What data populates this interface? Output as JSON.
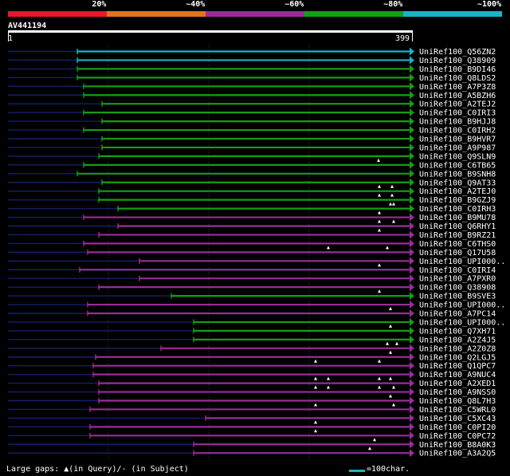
{
  "legend": {
    "segments": [
      {
        "color": "#e8172b"
      },
      {
        "color": "#e27419"
      },
      {
        "color": "#9a2c99"
      },
      {
        "color": "#12a012"
      },
      {
        "color": "#17b5c6"
      }
    ],
    "labels": [
      "20%",
      "~40%",
      "~60%",
      "~80%",
      "~100%"
    ]
  },
  "query": {
    "name": "AV441194",
    "start": "1",
    "end": "399"
  },
  "hits": [
    {
      "name": "UniRef100_Q56ZN2",
      "start": 97,
      "color": "#17b5c6",
      "marks": []
    },
    {
      "name": "UniRef100_Q38909",
      "start": 97,
      "color": "#17b5c6",
      "marks": []
    },
    {
      "name": "UniRef100_B9DI46",
      "start": 97,
      "color": "#12a012",
      "marks": []
    },
    {
      "name": "UniRef100_Q8LDS2",
      "start": 97,
      "color": "#12a012",
      "marks": []
    },
    {
      "name": "UniRef100_A7P3Z8",
      "start": 105,
      "color": "#12a012",
      "marks": []
    },
    {
      "name": "UniRef100_A5BZH6",
      "start": 105,
      "color": "#12a012",
      "marks": []
    },
    {
      "name": "UniRef100_A2TEJ2",
      "start": 128,
      "color": "#12a012",
      "marks": []
    },
    {
      "name": "UniRef100_C0IRI3",
      "start": 105,
      "color": "#12a012",
      "marks": []
    },
    {
      "name": "UniRef100_B9HJJ8",
      "start": 128,
      "color": "#12a012",
      "marks": []
    },
    {
      "name": "UniRef100_C0IRH2",
      "start": 105,
      "color": "#12a012",
      "marks": []
    },
    {
      "name": "UniRef100_B9HVR7",
      "start": 128,
      "color": "#12a012",
      "marks": []
    },
    {
      "name": "UniRef100_A9P987",
      "start": 128,
      "color": "#12a012",
      "marks": []
    },
    {
      "name": "UniRef100_Q9SLN9",
      "start": 124,
      "color": "#12a012",
      "marks": []
    },
    {
      "name": "UniRef100_C6TB65",
      "start": 105,
      "color": "#12a012",
      "marks": [
        475
      ]
    },
    {
      "name": "UniRef100_B9SNH8",
      "start": 97,
      "color": "#12a012",
      "marks": []
    },
    {
      "name": "UniRef100_Q9AT33",
      "start": 128,
      "color": "#12a012",
      "marks": []
    },
    {
      "name": "UniRef100_A2TEJ0",
      "start": 124,
      "color": "#12a012",
      "marks": [
        476,
        492
      ]
    },
    {
      "name": "UniRef100_B9GZJ9",
      "start": 124,
      "color": "#12a012",
      "marks": [
        476,
        492
      ]
    },
    {
      "name": "UniRef100_C0IRH3",
      "start": 148,
      "color": "#12a012",
      "marks": [
        490,
        494
      ]
    },
    {
      "name": "UniRef100_B9MU78",
      "start": 105,
      "color": "#9a2c99",
      "marks": [
        476
      ]
    },
    {
      "name": "UniRef100_Q6RHY1",
      "start": 148,
      "color": "#9a2c99",
      "marks": [
        476,
        494
      ]
    },
    {
      "name": "UniRef100_B9RZ21",
      "start": 124,
      "color": "#9a2c99",
      "marks": [
        476
      ]
    },
    {
      "name": "UniRef100_C6THS0",
      "start": 105,
      "color": "#9a2c99",
      "marks": []
    },
    {
      "name": "UniRef100_Q17U58",
      "start": 110,
      "color": "#9a2c99",
      "marks": [
        412,
        486
      ]
    },
    {
      "name": "UniRef100_UPI000..",
      "start": 175,
      "color": "#9a2c99",
      "marks": []
    },
    {
      "name": "UniRef100_C0IRI4",
      "start": 100,
      "color": "#9a2c99",
      "marks": [
        476
      ]
    },
    {
      "name": "UniRef100_A7PXR0",
      "start": 175,
      "color": "#9a2c99",
      "marks": []
    },
    {
      "name": "UniRef100_Q38908",
      "start": 124,
      "color": "#9a2c99",
      "marks": []
    },
    {
      "name": "UniRef100_B9SVE3",
      "start": 215,
      "color": "#12a012",
      "marks": [
        476
      ]
    },
    {
      "name": "UniRef100_UPI000..",
      "start": 110,
      "color": "#9a2c99",
      "marks": []
    },
    {
      "name": "UniRef100_A7PC14",
      "start": 110,
      "color": "#9a2c99",
      "marks": [
        490
      ]
    },
    {
      "name": "UniRef100_UPI000..",
      "start": 243,
      "color": "#12a012",
      "marks": []
    },
    {
      "name": "UniRef100_Q7XH71",
      "start": 243,
      "color": "#12a012",
      "marks": [
        490
      ]
    },
    {
      "name": "UniRef100_A2Z4J5",
      "start": 243,
      "color": "#12a012",
      "marks": []
    },
    {
      "name": "UniRef100_A2Z0Z8",
      "start": 202,
      "color": "#9a2c99",
      "marks": [
        486,
        498
      ]
    },
    {
      "name": "UniRef100_Q2LGJ5",
      "start": 120,
      "color": "#9a2c99",
      "marks": [
        490
      ]
    },
    {
      "name": "UniRef100_Q1QPC7",
      "start": 117,
      "color": "#9a2c99",
      "marks": [
        396,
        476
      ]
    },
    {
      "name": "UniRef100_A9NUC4",
      "start": 117,
      "color": "#9a2c99",
      "marks": []
    },
    {
      "name": "UniRef100_A2XED1",
      "start": 124,
      "color": "#9a2c99",
      "marks": [
        396,
        412,
        476,
        490
      ]
    },
    {
      "name": "UniRef100_A9NSS0",
      "start": 124,
      "color": "#9a2c99",
      "marks": [
        396,
        412,
        476,
        494
      ]
    },
    {
      "name": "UniRef100_Q8L7H3",
      "start": 124,
      "color": "#9a2c99",
      "marks": [
        490
      ]
    },
    {
      "name": "UniRef100_C5WRL0",
      "start": 113,
      "color": "#9a2c99",
      "marks": [
        396,
        494
      ]
    },
    {
      "name": "UniRef100_C5XC43",
      "start": 258,
      "color": "#9a2c99",
      "marks": []
    },
    {
      "name": "UniRef100_C0PI20",
      "start": 113,
      "color": "#9a2c99",
      "marks": [
        396
      ]
    },
    {
      "name": "UniRef100_C0PC72",
      "start": 113,
      "color": "#9a2c99",
      "marks": [
        396
      ]
    },
    {
      "name": "UniRef100_B8A0K3",
      "start": 243,
      "color": "#9a2c99",
      "marks": [
        470
      ]
    },
    {
      "name": "UniRef100_A3A2Q5",
      "start": 243,
      "color": "#9a2c99",
      "marks": [
        464
      ]
    }
  ],
  "footer": {
    "gaps_label": "Large gaps: ▲(in Query)/- (in Subject)",
    "scale_color": "#17b5c6",
    "scale_label": "=100char."
  }
}
